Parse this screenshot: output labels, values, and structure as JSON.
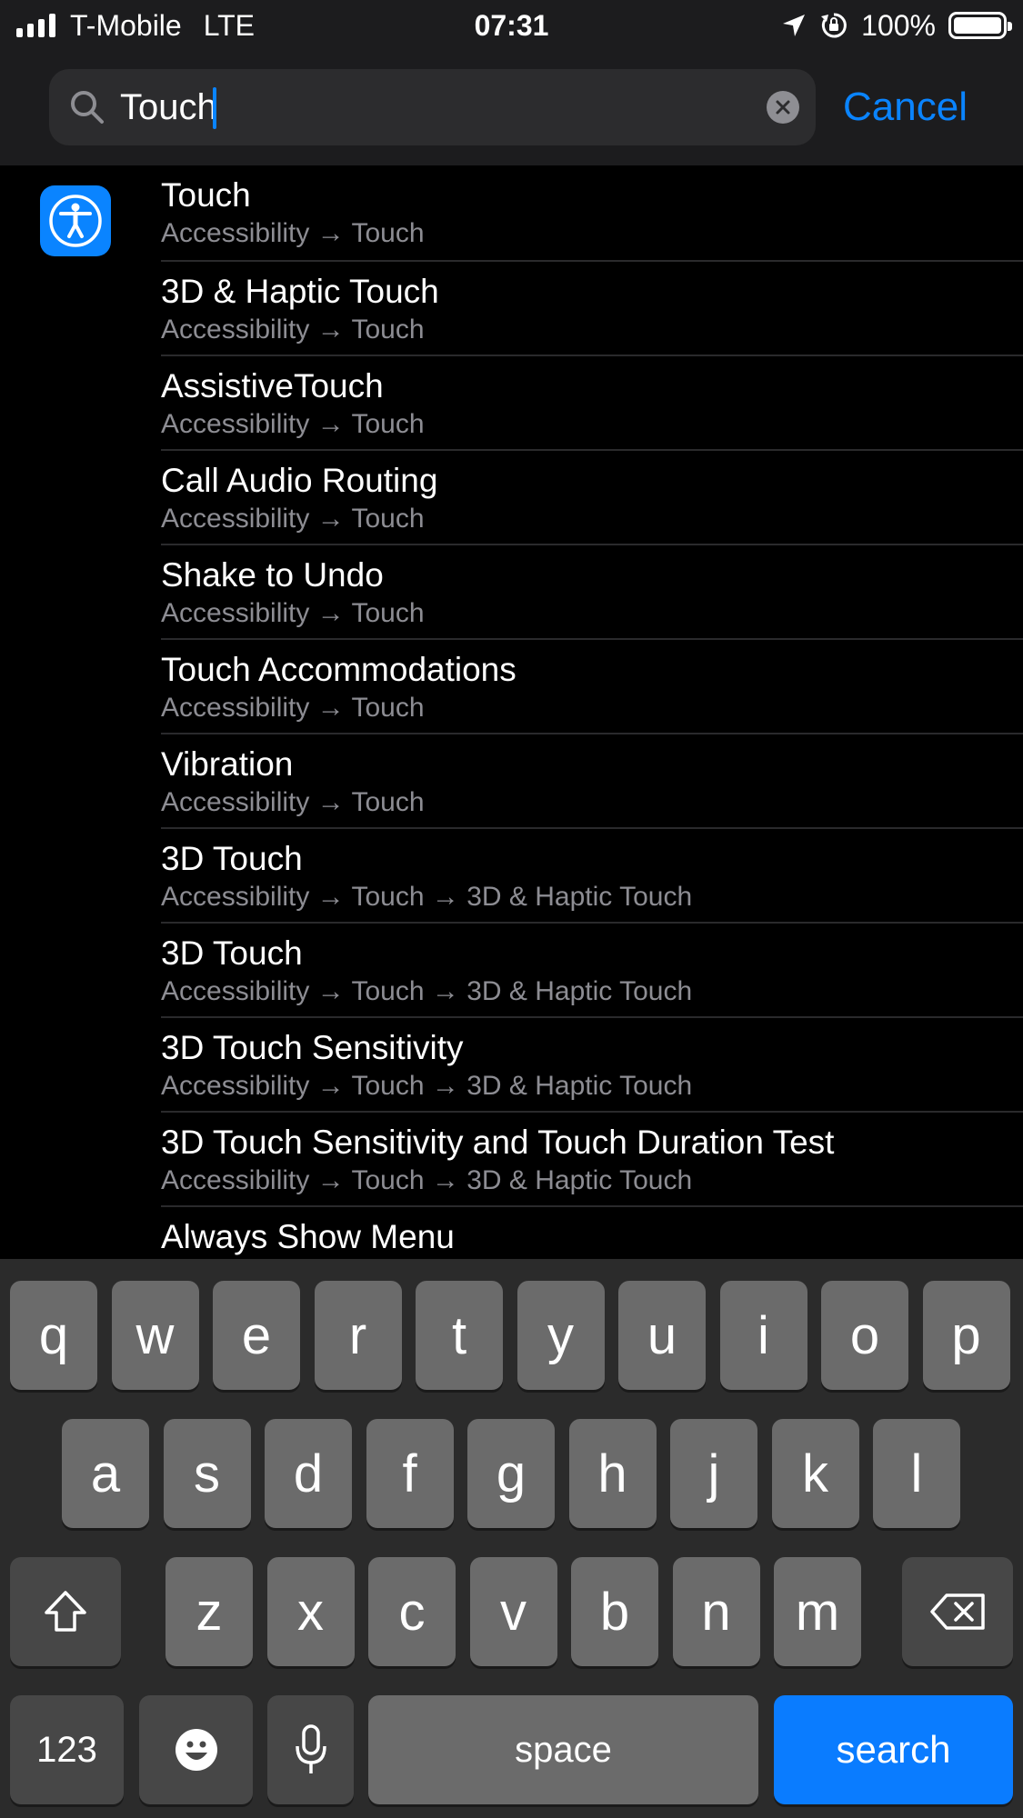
{
  "status_bar": {
    "carrier": "T-Mobile",
    "network": "LTE",
    "time": "07:31",
    "battery_percent": "100%",
    "signal_bars": 4,
    "icons": [
      "signal-icon",
      "location-arrow-icon",
      "orientation-lock-icon",
      "battery-icon"
    ]
  },
  "search": {
    "value": "Touch",
    "clear_icon": "clear-circle-icon",
    "cancel_label": "Cancel"
  },
  "results": {
    "app_icon": "accessibility-icon",
    "items": [
      {
        "title": "Touch",
        "path": "Accessibility → Touch"
      },
      {
        "title": "3D & Haptic Touch",
        "path": "Accessibility → Touch"
      },
      {
        "title": "AssistiveTouch",
        "path": "Accessibility → Touch"
      },
      {
        "title": "Call Audio Routing",
        "path": "Accessibility → Touch"
      },
      {
        "title": "Shake to Undo",
        "path": "Accessibility → Touch"
      },
      {
        "title": "Touch Accommodations",
        "path": "Accessibility → Touch"
      },
      {
        "title": "Vibration",
        "path": "Accessibility → Touch"
      },
      {
        "title": "3D Touch",
        "path": "Accessibility → Touch → 3D & Haptic Touch"
      },
      {
        "title": "3D Touch",
        "path": "Accessibility → Touch → 3D & Haptic Touch"
      },
      {
        "title": "3D Touch Sensitivity",
        "path": "Accessibility → Touch → 3D & Haptic Touch"
      },
      {
        "title": "3D Touch Sensitivity and Touch Duration Test",
        "path": "Accessibility → Touch → 3D & Haptic Touch"
      },
      {
        "title": "Always Show Menu",
        "path": ""
      }
    ]
  },
  "keyboard": {
    "row1": [
      "q",
      "w",
      "e",
      "r",
      "t",
      "y",
      "u",
      "i",
      "o",
      "p"
    ],
    "row2": [
      "a",
      "s",
      "d",
      "f",
      "g",
      "h",
      "j",
      "k",
      "l"
    ],
    "row3": [
      "z",
      "x",
      "c",
      "v",
      "b",
      "n",
      "m"
    ],
    "numbers_label": "123",
    "space_label": "space",
    "search_label": "search",
    "icons": [
      "shift-icon",
      "backspace-icon",
      "emoji-icon",
      "microphone-icon"
    ]
  },
  "colors": {
    "accent": "#0a84ff",
    "background": "#000000",
    "header": "#1c1c1e",
    "secondary_text": "#8d8d93"
  }
}
